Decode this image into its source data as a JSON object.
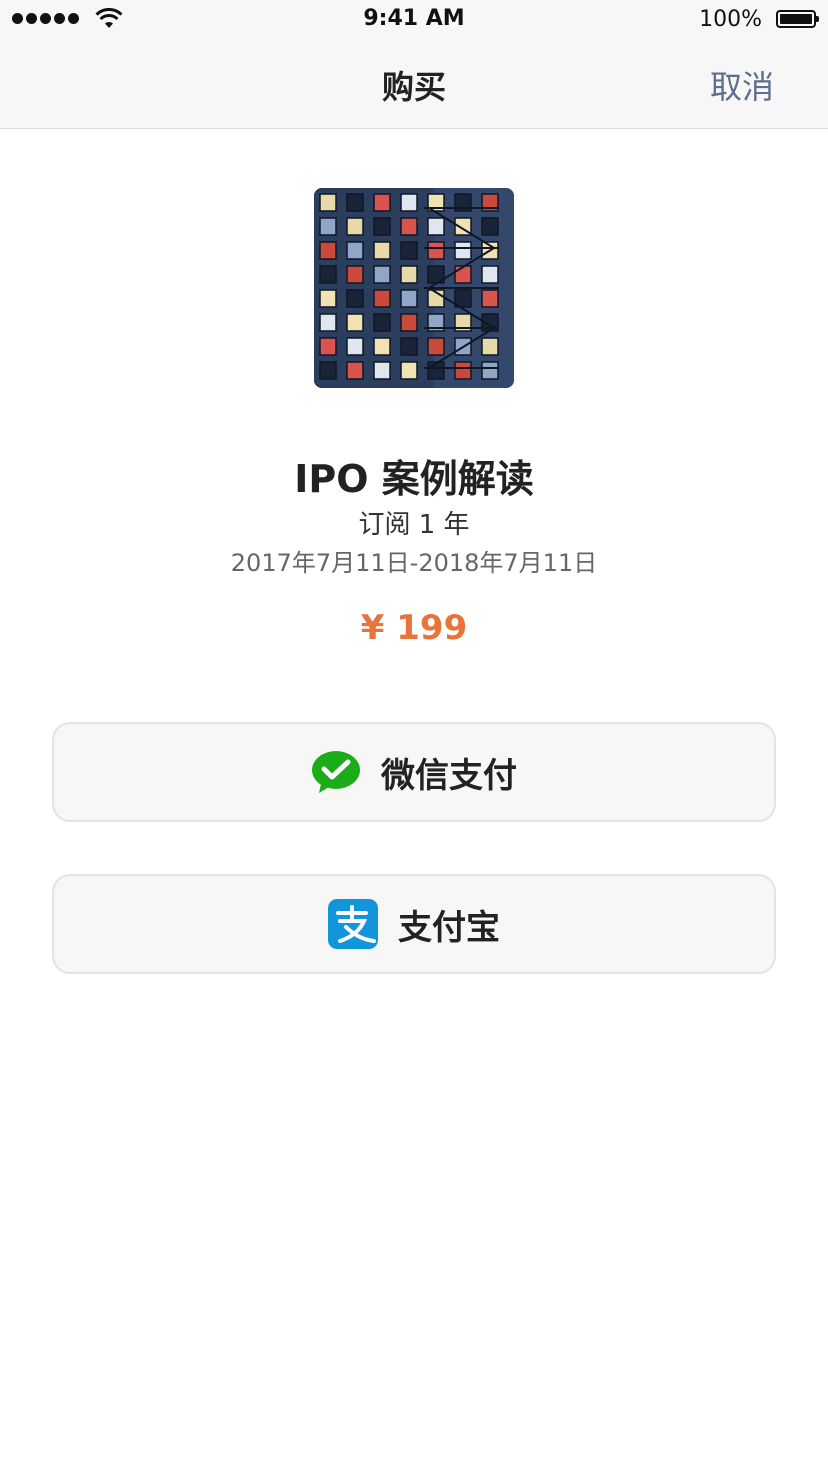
{
  "status_bar": {
    "time": "9:41 AM",
    "battery": "100%"
  },
  "nav": {
    "title": "购买",
    "cancel_label": "取消"
  },
  "product": {
    "title": "IPO 案例解读",
    "subscription": "订阅 1 年",
    "period": "2017年7月11日-2018年7月11日",
    "price": "¥ 199"
  },
  "payment": {
    "wechat_label": "微信支付",
    "alipay_label": "支付宝",
    "wechat_color": "#1aad19",
    "alipay_color": "#1296db"
  },
  "icons": {
    "signal": "signal-dots-icon",
    "wifi": "wifi-icon",
    "battery": "battery-icon",
    "wechat_pay": "wechat-pay-icon",
    "alipay": "alipay-icon"
  }
}
